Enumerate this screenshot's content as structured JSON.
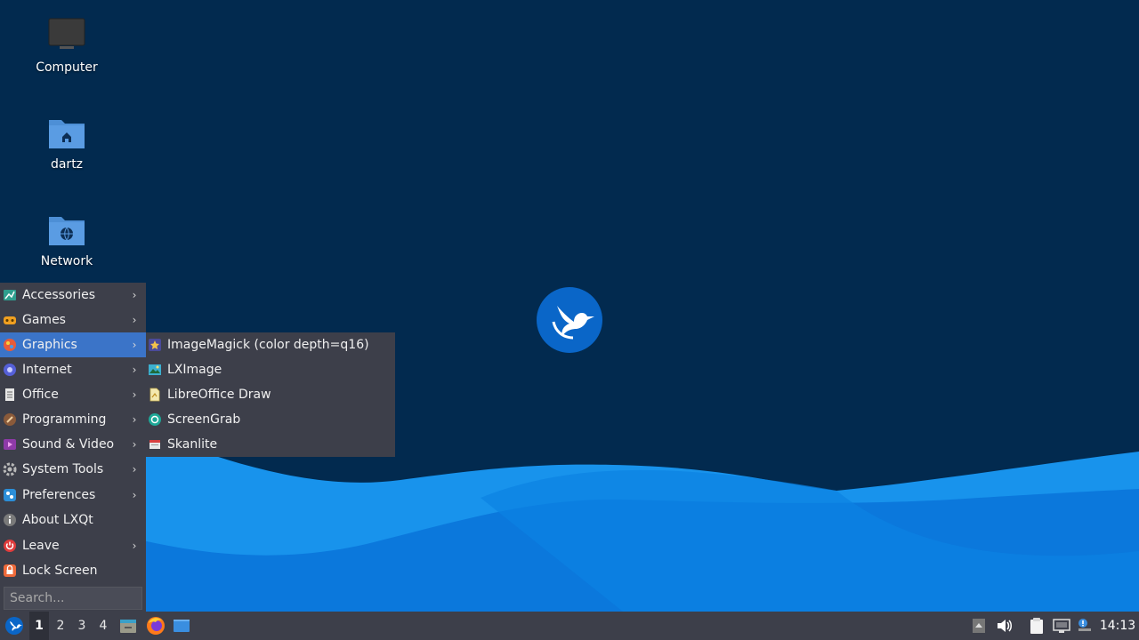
{
  "desktop": {
    "icons": [
      {
        "label": "Computer",
        "icon": "computer-icon"
      },
      {
        "label": "dartz",
        "icon": "home-folder-icon"
      },
      {
        "label": "Network",
        "icon": "network-folder-icon"
      }
    ],
    "logo": "lubuntu-bird-logo"
  },
  "main_menu": {
    "items": [
      {
        "label": "Accessories",
        "icon": "accessories-icon",
        "submenu": true
      },
      {
        "label": "Games",
        "icon": "games-icon",
        "submenu": true
      },
      {
        "label": "Graphics",
        "icon": "graphics-icon",
        "submenu": true,
        "active": true
      },
      {
        "label": "Internet",
        "icon": "internet-icon",
        "submenu": true
      },
      {
        "label": "Office",
        "icon": "office-icon",
        "submenu": true
      },
      {
        "label": "Programming",
        "icon": "programming-icon",
        "submenu": true
      },
      {
        "label": "Sound & Video",
        "icon": "sound-video-icon",
        "submenu": true
      },
      {
        "label": "System Tools",
        "icon": "system-tools-icon",
        "submenu": true
      },
      {
        "label": "Preferences",
        "icon": "preferences-icon",
        "submenu": true
      },
      {
        "label": "About LXQt",
        "icon": "info-icon",
        "submenu": false
      },
      {
        "label": "Leave",
        "icon": "power-icon",
        "submenu": true
      },
      {
        "label": "Lock Screen",
        "icon": "lock-icon",
        "submenu": false
      }
    ],
    "search_placeholder": "Search..."
  },
  "graphics_submenu": {
    "items": [
      {
        "label": "ImageMagick (color depth=q16)",
        "icon": "imagemagick-icon"
      },
      {
        "label": "LXImage",
        "icon": "lximage-icon"
      },
      {
        "label": "LibreOffice Draw",
        "icon": "libreoffice-draw-icon"
      },
      {
        "label": "ScreenGrab",
        "icon": "screengrab-icon"
      },
      {
        "label": "Skanlite",
        "icon": "skanlite-icon"
      }
    ]
  },
  "taskbar": {
    "start_icon": "lubuntu-start-icon",
    "desktops": [
      "1",
      "2",
      "3",
      "4"
    ],
    "current_desktop": "1",
    "launchers": [
      "file-manager-icon",
      "firefox-icon",
      "show-desktop-icon"
    ],
    "tray": [
      "tray-expand-icon",
      "volume-icon",
      "clipboard-icon",
      "network-tray-icon",
      "update-notifier-icon"
    ],
    "clock": "14:13"
  },
  "colors": {
    "desktop_bg": "#022a4f",
    "wave_light": "#1a9cf0",
    "wave_mid": "#0b7fe0",
    "menu_bg": "#3d3f4a",
    "menu_highlight": "#3b74c8"
  }
}
